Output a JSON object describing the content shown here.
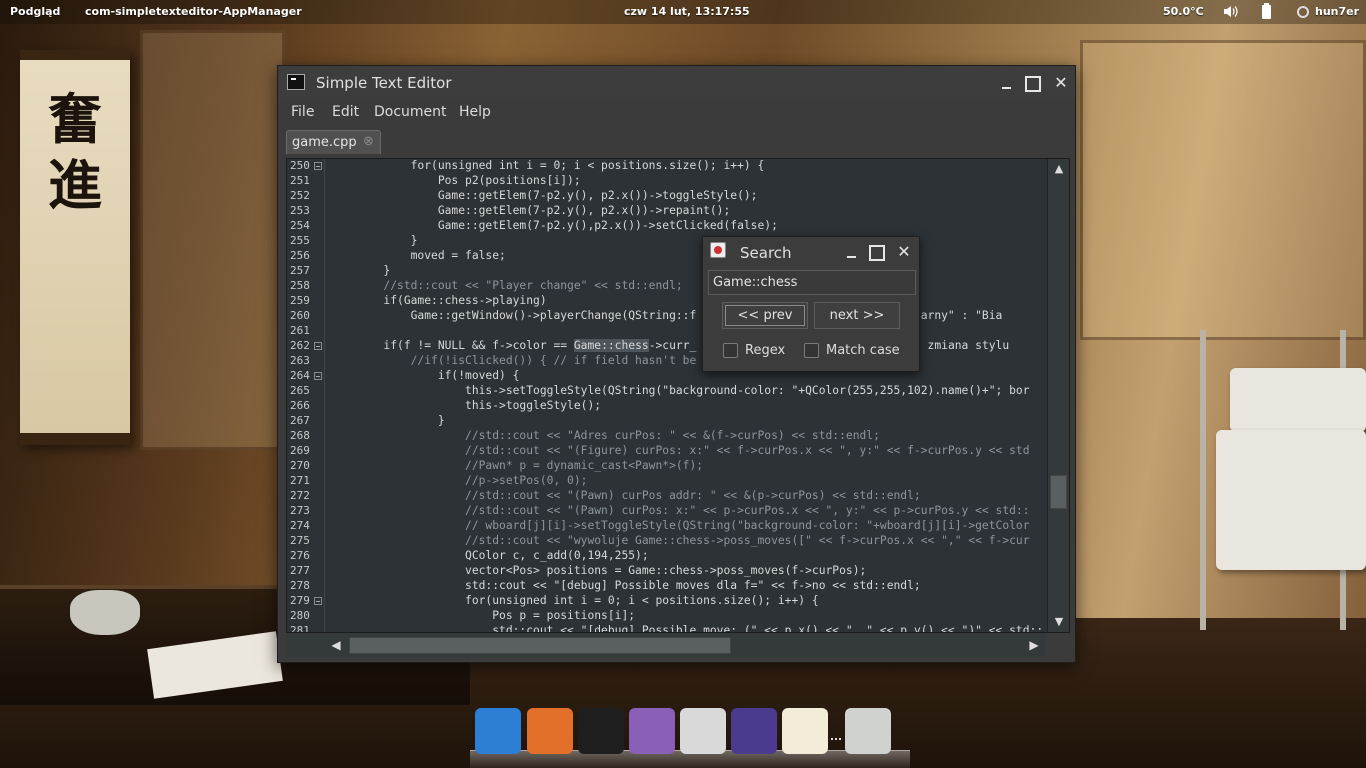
{
  "top_panel": {
    "app_menu": "Podgląd",
    "window_name": "com-simpletexteditor-AppManager",
    "clock": "czw 14 lut, 13:17:55",
    "temperature": "50.0°C",
    "username": "hun7er"
  },
  "desktop": {
    "calligraphy": "奮\n進"
  },
  "editor": {
    "title": "Simple Text Editor",
    "close_glyph": "✕",
    "menu": [
      "File",
      "Edit",
      "Document",
      "Help"
    ],
    "tab": {
      "label": "game.cpp",
      "close": "⊗"
    },
    "lines": [
      {
        "n": "250",
        "fold": true,
        "cls": "",
        "parts": [
          [
            "            for(unsigned int i = 0; i < positions.size(); i++) {",
            ""
          ]
        ]
      },
      {
        "n": "251",
        "fold": false,
        "cls": "",
        "parts": [
          [
            "                Pos p2(positions[i]);",
            ""
          ]
        ]
      },
      {
        "n": "252",
        "fold": false,
        "cls": "",
        "parts": [
          [
            "                Game::getElem(7-p2.y(), p2.x())->toggleStyle();",
            ""
          ]
        ]
      },
      {
        "n": "253",
        "fold": false,
        "cls": "",
        "parts": [
          [
            "                Game::getElem(7-p2.y(), p2.x())->repaint();",
            ""
          ]
        ]
      },
      {
        "n": "254",
        "fold": false,
        "cls": "",
        "parts": [
          [
            "                Game::getElem(7-p2.y(),p2.x())->setClicked(false);",
            ""
          ]
        ]
      },
      {
        "n": "255",
        "fold": false,
        "cls": "",
        "parts": [
          [
            "            }",
            ""
          ]
        ]
      },
      {
        "n": "256",
        "fold": false,
        "cls": "",
        "parts": [
          [
            "            moved = false;",
            ""
          ]
        ]
      },
      {
        "n": "257",
        "fold": false,
        "cls": "",
        "parts": [
          [
            "        }",
            ""
          ]
        ]
      },
      {
        "n": "258",
        "fold": false,
        "cls": "cmt",
        "parts": [
          [
            "        //std::cout << \"Player change\" << std::endl;",
            ""
          ]
        ]
      },
      {
        "n": "259",
        "fold": false,
        "cls": "",
        "parts": [
          [
            "        if(Game::chess->playing)",
            ""
          ]
        ]
      },
      {
        "n": "260",
        "fold": false,
        "cls": "",
        "parts": [
          [
            "            Game::getWindow()->playerChange(QString::f                            ? \"Czarny\" : \"Bia",
            ""
          ]
        ]
      },
      {
        "n": "261",
        "fold": false,
        "cls": "",
        "parts": [
          [
            "",
            ""
          ]
        ]
      },
      {
        "n": "262",
        "fold": true,
        "cls": "",
        "parts": [
          [
            "        if(f != NULL && f->color == ",
            ""
          ],
          [
            "Game::chess",
            "hl"
          ],
          [
            "->curr_                             { // zmiana stylu",
            ""
          ]
        ]
      },
      {
        "n": "263",
        "fold": false,
        "cls": "cmt",
        "parts": [
          [
            "            //if(!isClicked()) { // if field hasn't be",
            ""
          ]
        ]
      },
      {
        "n": "264",
        "fold": true,
        "cls": "",
        "parts": [
          [
            "                if(!moved) {",
            ""
          ]
        ]
      },
      {
        "n": "265",
        "fold": false,
        "cls": "",
        "parts": [
          [
            "                    this->setToggleStyle(QString(\"background-color: \"+QColor(255,255,102).name()+\"; bor",
            ""
          ]
        ]
      },
      {
        "n": "266",
        "fold": false,
        "cls": "",
        "parts": [
          [
            "                    this->toggleStyle();",
            ""
          ]
        ]
      },
      {
        "n": "267",
        "fold": false,
        "cls": "",
        "parts": [
          [
            "                }",
            ""
          ]
        ]
      },
      {
        "n": "268",
        "fold": false,
        "cls": "cmt",
        "parts": [
          [
            "                    //std::cout << \"Adres curPos: \" << &(f->curPos) << std::endl;",
            ""
          ]
        ]
      },
      {
        "n": "269",
        "fold": false,
        "cls": "cmt",
        "parts": [
          [
            "                    //std::cout << \"(Figure) curPos: x:\" << f->curPos.x << \", y:\" << f->curPos.y << std",
            ""
          ]
        ]
      },
      {
        "n": "270",
        "fold": false,
        "cls": "cmt",
        "parts": [
          [
            "                    //Pawn* p = dynamic_cast<Pawn*>(f);",
            ""
          ]
        ]
      },
      {
        "n": "271",
        "fold": false,
        "cls": "cmt",
        "parts": [
          [
            "                    //p->setPos(0, 0);",
            ""
          ]
        ]
      },
      {
        "n": "272",
        "fold": false,
        "cls": "cmt",
        "parts": [
          [
            "                    //std::cout << \"(Pawn) curPos addr: \" << &(p->curPos) << std::endl;",
            ""
          ]
        ]
      },
      {
        "n": "273",
        "fold": false,
        "cls": "cmt",
        "parts": [
          [
            "                    //std::cout << \"(Pawn) curPos: x:\" << p->curPos.x << \", y:\" << p->curPos.y << std::",
            ""
          ]
        ]
      },
      {
        "n": "274",
        "fold": false,
        "cls": "cmt",
        "parts": [
          [
            "                    // wboard[j][i]->setToggleStyle(QString(\"background-color: \"+wboard[j][i]->getColor",
            ""
          ]
        ]
      },
      {
        "n": "275",
        "fold": false,
        "cls": "cmt",
        "parts": [
          [
            "                    //std::cout << \"wywoluje Game::chess->poss_moves([\" << f->curPos.x << \",\" << f->cur",
            ""
          ]
        ]
      },
      {
        "n": "276",
        "fold": false,
        "cls": "",
        "parts": [
          [
            "                    QColor c, c_add(0,194,255);",
            ""
          ]
        ]
      },
      {
        "n": "277",
        "fold": false,
        "cls": "",
        "parts": [
          [
            "                    vector<Pos> positions = Game::chess->poss_moves(f->curPos);",
            ""
          ]
        ]
      },
      {
        "n": "278",
        "fold": false,
        "cls": "",
        "parts": [
          [
            "                    std::cout << \"[debug] Possible moves dla f=\" << f->no << std::endl;",
            ""
          ]
        ]
      },
      {
        "n": "279",
        "fold": true,
        "cls": "",
        "parts": [
          [
            "                    for(unsigned int i = 0; i < positions.size(); i++) {",
            ""
          ]
        ]
      },
      {
        "n": "280",
        "fold": false,
        "cls": "",
        "parts": [
          [
            "                        Pos p = positions[i];",
            ""
          ]
        ]
      },
      {
        "n": "281",
        "fold": false,
        "cls": "",
        "parts": [
          [
            "                        std::cout << \"[debug] Possible move: (\" << p.x() << \", \" << p.y() << \")\" << std::",
            ""
          ]
        ]
      }
    ],
    "scroll": {
      "up": "▲",
      "down": "▼",
      "left": "◀",
      "right": "▶"
    }
  },
  "search_dialog": {
    "title": "Search",
    "query": "Game::chess",
    "prev_label": "<< prev",
    "next_label": "next >>",
    "regex_label": "Regex",
    "match_case_label": "Match case",
    "close_glyph": "✕"
  },
  "dock": {
    "apps": [
      {
        "name": "anchor-icon",
        "color": "#2d7fd6"
      },
      {
        "name": "firefox-icon",
        "color": "#e3702a"
      },
      {
        "name": "terminal-icon",
        "color": "#1e1e1e"
      },
      {
        "name": "pidgin-icon",
        "color": "#8a5fb8"
      },
      {
        "name": "file-manager-icon",
        "color": "#d9d9d9"
      },
      {
        "name": "eclipse-icon",
        "color": "#4b3b8f"
      },
      {
        "name": "text-editor-icon",
        "color": "#f2ecd8"
      },
      {
        "name": "trash-icon",
        "color": "#cfd2cf"
      }
    ]
  }
}
